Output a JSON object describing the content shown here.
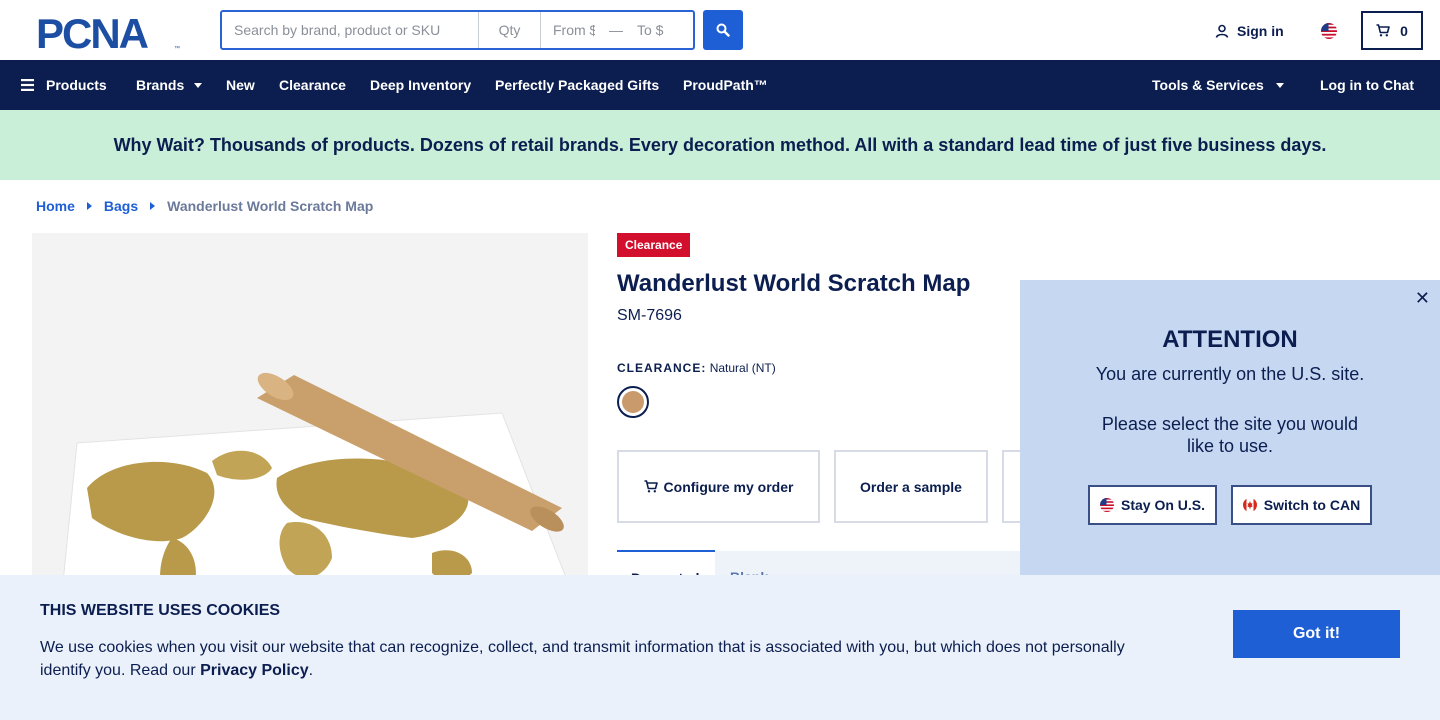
{
  "brand": {
    "logo_text": "PCNA",
    "accent": "#1f5fd6",
    "navy": "#0b1e4f"
  },
  "search": {
    "placeholder": "Search by brand, product or SKU",
    "qty_placeholder": "Qty",
    "from_placeholder": "From $",
    "to_placeholder": "To $",
    "icon": "search-icon"
  },
  "header": {
    "signin_label": "Sign in",
    "cart_count": "0"
  },
  "nav": {
    "products": "Products",
    "brands": "Brands",
    "new": "New",
    "clearance": "Clearance",
    "deep_inventory": "Deep Inventory",
    "gifts": "Perfectly Packaged Gifts",
    "proudpath": "ProudPath™",
    "tools": "Tools & Services",
    "chat": "Log in to Chat"
  },
  "promo": {
    "text": "Why Wait? Thousands of products. Dozens of retail brands. Every decoration method. All with a standard lead time of just five business days."
  },
  "breadcrumb": {
    "home": "Home",
    "bags": "Bags",
    "current": "Wanderlust World Scratch Map"
  },
  "product": {
    "badge": "Clearance",
    "title": "Wanderlust World Scratch Map",
    "sku": "SM-7696",
    "color_label": "CLEARANCE:",
    "color_value": "Natural (NT)",
    "swatch_color": "#c99a6c",
    "configure_label": "Configure my order",
    "sample_label": "Order a sample",
    "tabs": [
      "Decorated",
      "Blank"
    ]
  },
  "popup": {
    "heading": "ATTENTION",
    "line1": "You are currently on the U.S. site.",
    "line2": "Please select the site you would like to use.",
    "stay_label": "Stay On U.S.",
    "switch_label": "Switch to CAN"
  },
  "cookies": {
    "heading": "THIS WEBSITE USES COOKIES",
    "text": "We use cookies when you visit our website that can recognize, collect, and transmit information that is associated with you, but which does not personally identify you. Read our ",
    "policy_link": "Privacy Policy",
    "period": ".",
    "button": "Got it!"
  }
}
